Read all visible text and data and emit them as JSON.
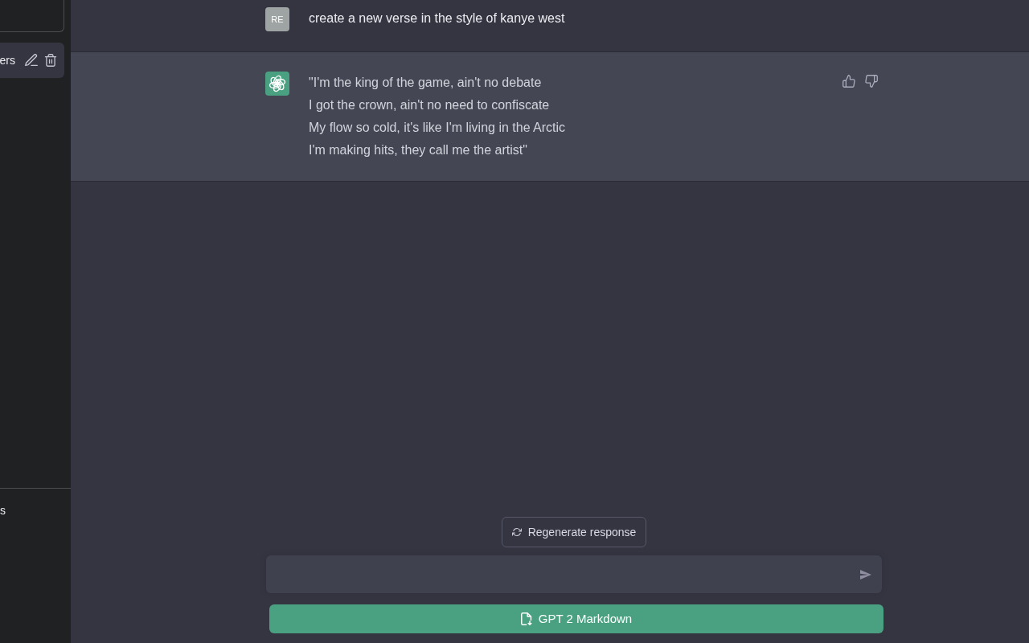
{
  "sidebar": {
    "conversations": [
      {
        "title": "ers",
        "selected": true
      }
    ],
    "bottom_items": [
      {
        "label": "s"
      }
    ]
  },
  "messages": [
    {
      "kind": "user",
      "avatar": "RE",
      "text": "create a new verse in the style of kanye west"
    },
    {
      "kind": "assistant",
      "text": "\"I'm the king of the game, ain't no debate\nI got the crown, ain't no need to confiscate\nMy flow so cold, it's like I'm living in the Arctic\nI'm making hits, they call me the artist\""
    }
  ],
  "regenerate_button": "Regenerate response",
  "export_button": "GPT 2 Markdown"
}
